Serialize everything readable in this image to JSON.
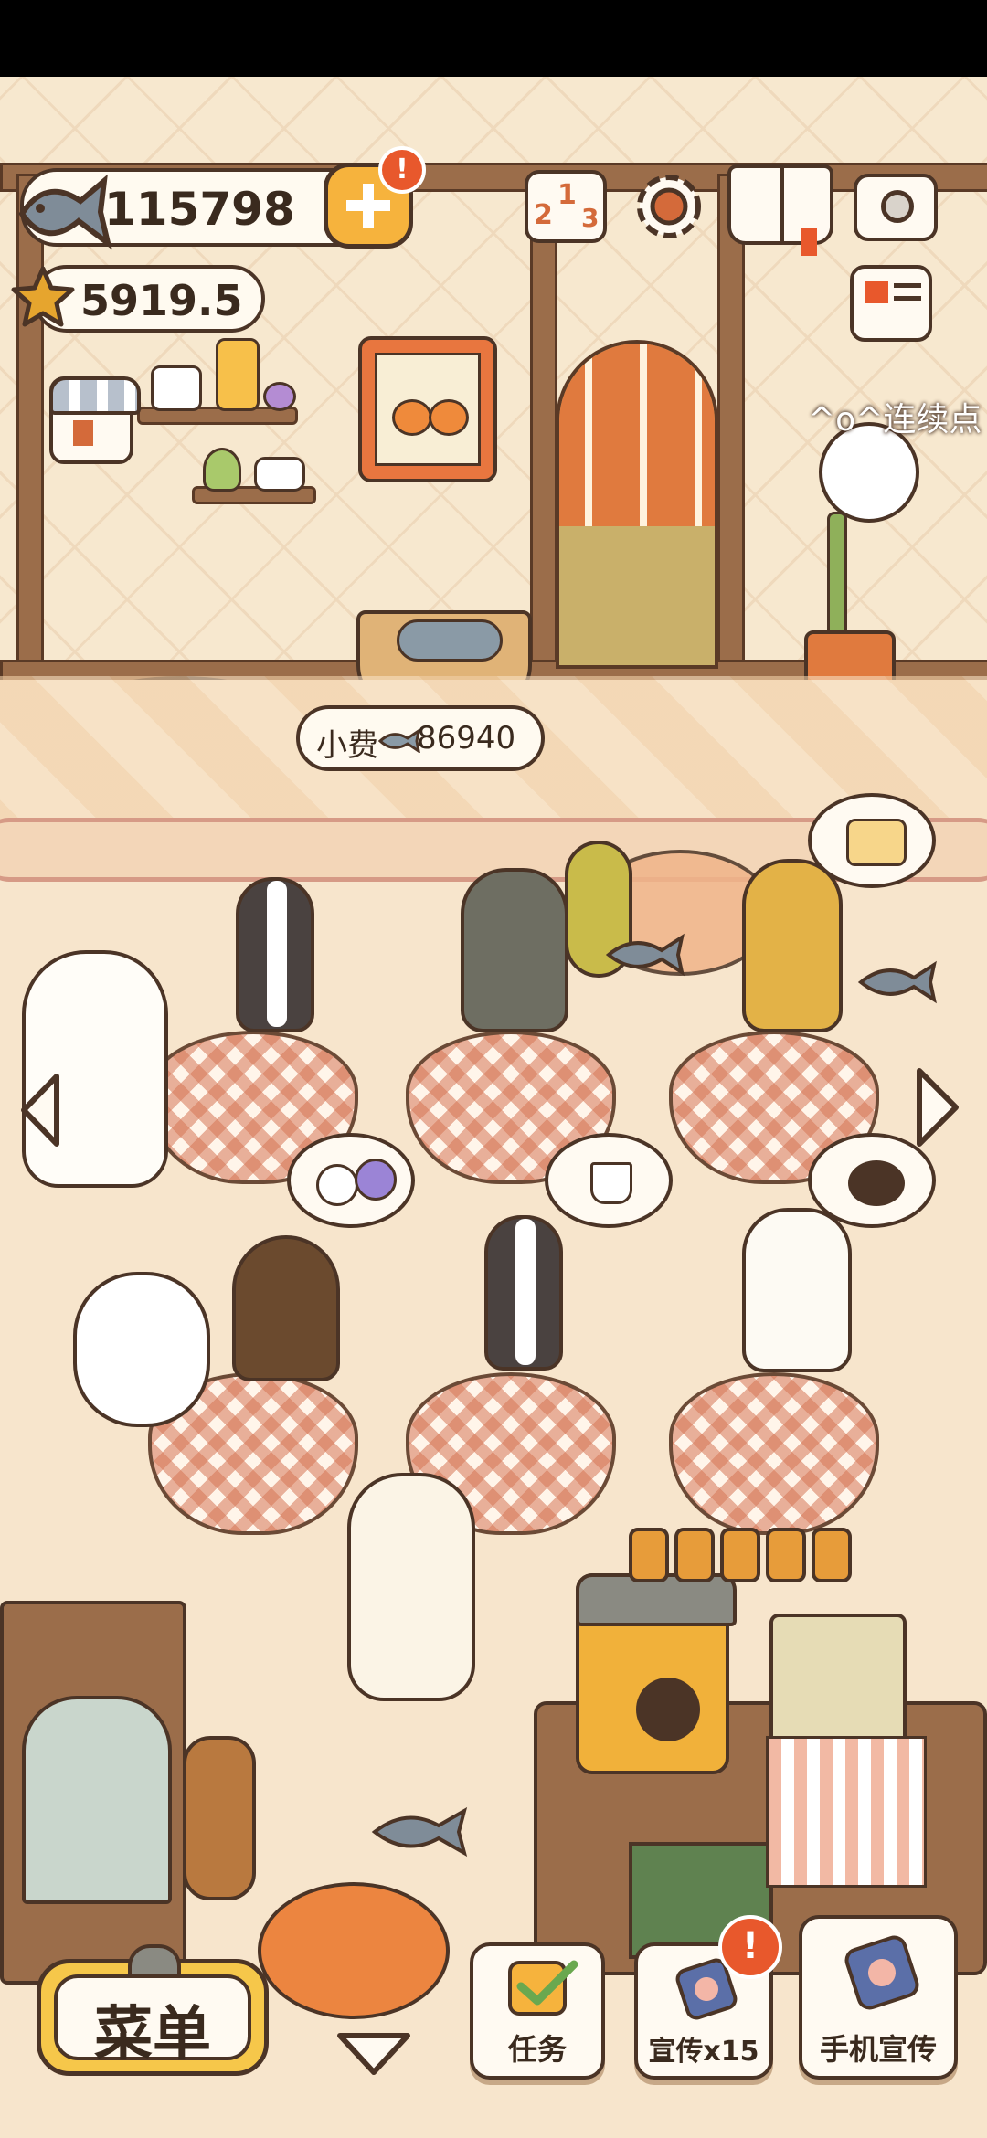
{
  "currency": {
    "fish_amount": "115798",
    "star_amount": "5919.5"
  },
  "hud": {
    "plus_badge": "!",
    "ranking_digits": [
      "2",
      "1",
      "3"
    ]
  },
  "scene": {
    "tip_label": "小费",
    "tip_amount": "86940",
    "combo_text": "^o^连续点"
  },
  "bottom_bar": {
    "menu_label": "菜单",
    "tasks_label": "任务",
    "promote_label": "宣传x15",
    "promote_badge": "!",
    "phone_promote_label": "手机宣传"
  },
  "colors": {
    "outline": "#4b3426",
    "badge_red": "#e8582c",
    "gold": "#f6b33d",
    "tablecloth": "#d67656",
    "wood": "#9b6d4a"
  },
  "icons": [
    "fish-icon",
    "star-icon",
    "plus-icon",
    "ranking-icon",
    "gear-icon",
    "guidebook-icon",
    "camera-icon",
    "newspaper-icon",
    "shop-icon",
    "left-arrow-icon",
    "right-arrow-icon",
    "down-arrow-icon",
    "tasks-checkbox-icon",
    "promote-icon",
    "phone-promote-icon"
  ]
}
